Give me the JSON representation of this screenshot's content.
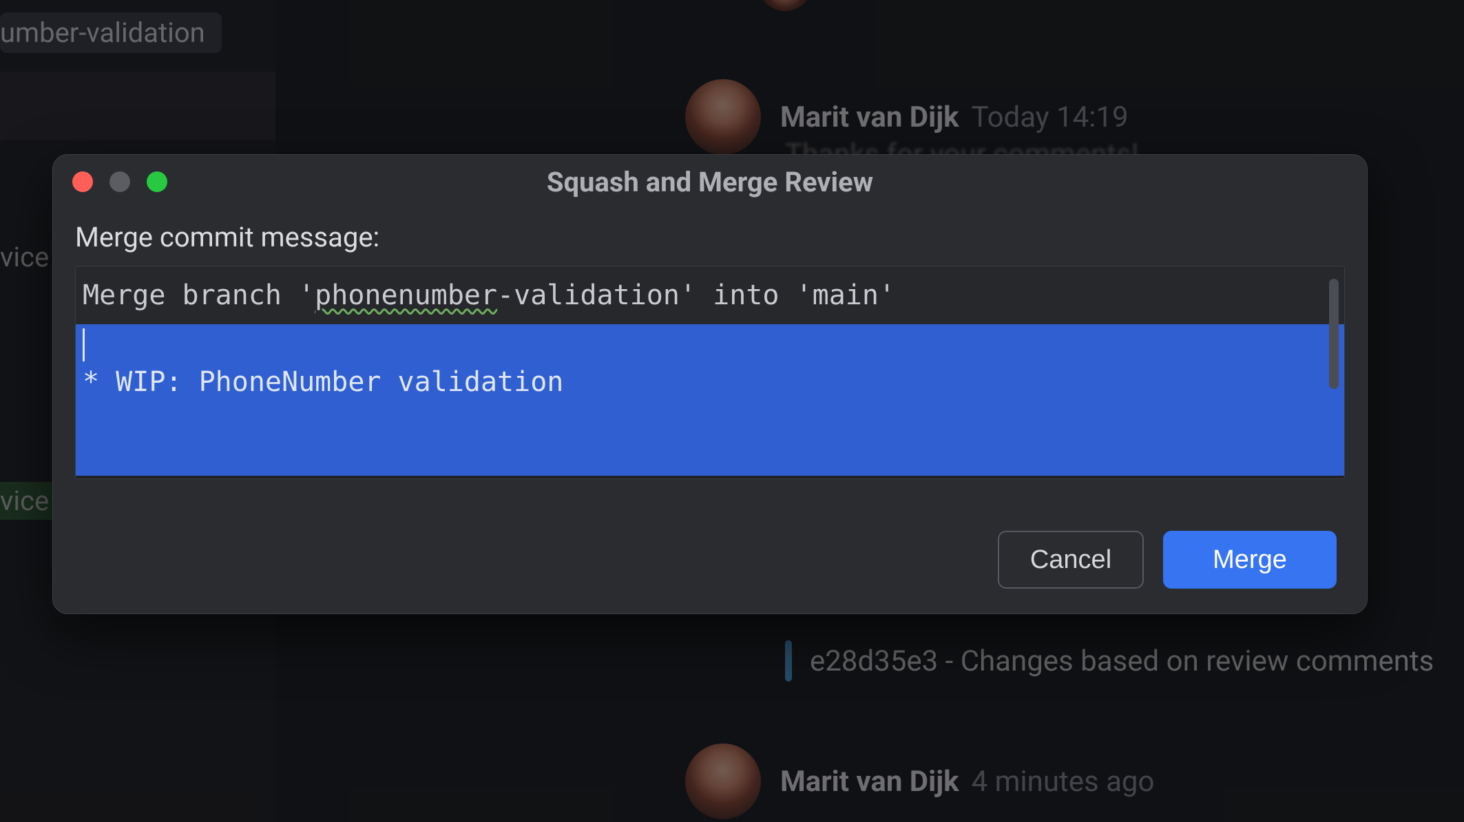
{
  "sidebar": {
    "branch_tag": "umber-validation",
    "item_text_1": "vice",
    "item_text_2": "vice"
  },
  "chat": {
    "msg1": {
      "author": "Marit van Dijk",
      "time": "Today 14:19",
      "partial_text": "Thanks for your comments!"
    },
    "commit_line": "e28d35e3 - Changes based on review comments",
    "msg2": {
      "author": "Marit van Dijk",
      "time": "4 minutes ago"
    }
  },
  "modal": {
    "title": "Squash and Merge Review",
    "label": "Merge commit message:",
    "commit_line1_prefix": "Merge branch '",
    "commit_line1_spell": "phonenumber",
    "commit_line1_suffix": "-validation' into 'main'",
    "commit_selection_text": "\n* WIP: PhoneNumber validation",
    "buttons": {
      "cancel": "Cancel",
      "merge": "Merge"
    }
  }
}
